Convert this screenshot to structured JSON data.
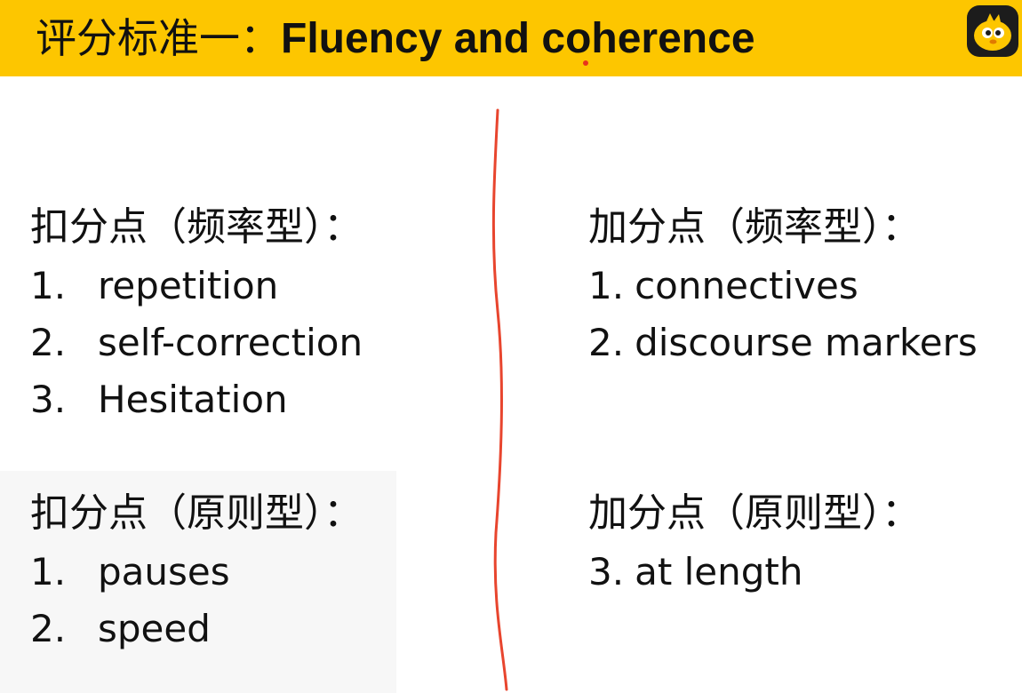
{
  "header": {
    "title_cn": "评分标准一：",
    "title_en": "Fluency and coherence"
  },
  "left": {
    "frequency": {
      "heading": "扣分点（频率型）：",
      "items": [
        {
          "num": "1.",
          "text": "repetition"
        },
        {
          "num": "2.",
          "text": "self-correction"
        },
        {
          "num": "3.",
          "text": "Hesitation"
        }
      ]
    },
    "principle": {
      "heading": "扣分点（原则型）：",
      "items": [
        {
          "num": "1.",
          "text": "pauses"
        },
        {
          "num": "2.",
          "text": "speed"
        }
      ]
    }
  },
  "right": {
    "frequency": {
      "heading": "加分点（频率型）：",
      "items": [
        {
          "num": "1.",
          "text": "connectives"
        },
        {
          "num": "2.",
          "text": "discourse markers"
        }
      ]
    },
    "principle": {
      "heading": "加分点（原则型）：",
      "items": [
        {
          "num": "3.",
          "text": "at length"
        }
      ]
    }
  },
  "colors": {
    "header_bg": "#fdc600",
    "divider": "#e8452e",
    "text": "#111111"
  }
}
